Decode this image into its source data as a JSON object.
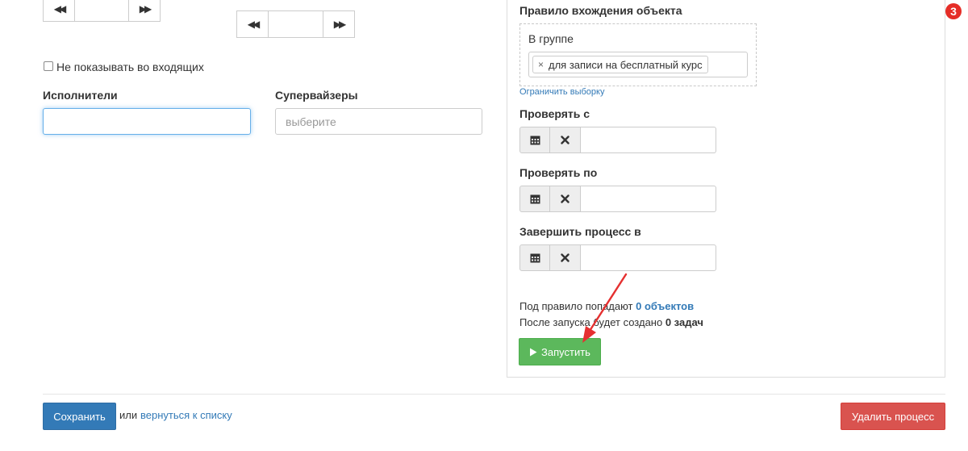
{
  "top_left": {
    "checkbox_label": "Не показывать во входящих"
  },
  "performers": {
    "label": "Исполнители",
    "value": ""
  },
  "supervisors": {
    "label": "Супервайзеры",
    "placeholder": "выберите"
  },
  "rule": {
    "title": "Правило вхождения объекта",
    "group_label": "В группе",
    "tag": "для записи на бесплатный курс",
    "tag_remove": "×",
    "restrict_link": "Ограничить выборку"
  },
  "check_from": {
    "label": "Проверять с"
  },
  "check_to": {
    "label": "Проверять по"
  },
  "finish_at": {
    "label": "Завершить процесс в"
  },
  "summary": {
    "line1_prefix": "Под правило попадают",
    "line1_count": "0 объектов",
    "line2_prefix": "После запуска будет создано",
    "line2_count": "0 задач"
  },
  "run_button": {
    "label": "Запустить"
  },
  "footer": {
    "save_label": "Сохранить",
    "or_text": "или",
    "back_link": "вернуться к списку",
    "delete_label": "Удалить процесс"
  },
  "badge": {
    "count": "3"
  },
  "colors": {
    "green": "#5cb85c",
    "blue": "#337ab7",
    "red": "#d9534f",
    "badge": "#e52d27",
    "arrow": "#e53030"
  },
  "icons": {
    "spinner_prev": "double-left-arrow",
    "spinner_next": "double-right-arrow",
    "calendar": "calendar-icon",
    "clear": "times-icon",
    "play": "play-icon"
  }
}
